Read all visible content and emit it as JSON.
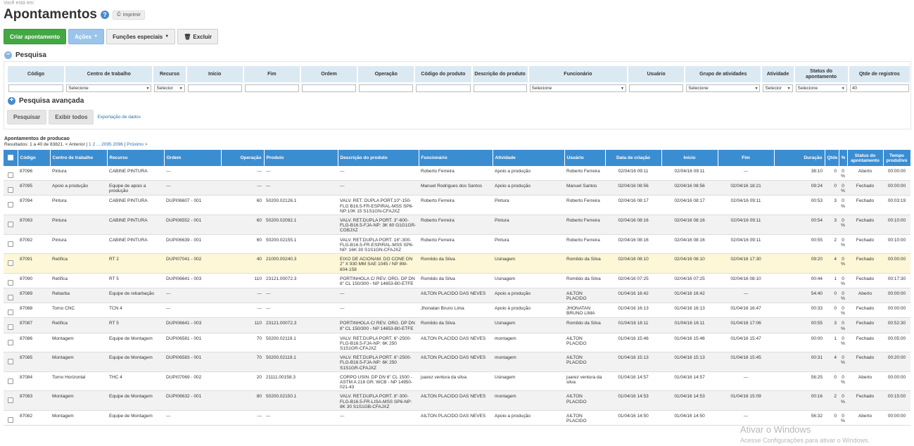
{
  "breadcrumb": "Você está em:",
  "page_title": "Apontamentos",
  "print_label": "Imprimir",
  "toolbar": {
    "create": "Criar apontamento",
    "actions": "Ações",
    "special": "Funções especiais",
    "delete": "Excluir"
  },
  "search": {
    "title": "Pesquisa",
    "advanced": "Pesquisa avançada",
    "search_btn": "Pesquisar",
    "show_all_btn": "Exibir todos",
    "export_link": "Exportação de dados",
    "columns": [
      {
        "label": "Código",
        "value": ""
      },
      {
        "label": "Centro de trabalho",
        "value": "Selecione"
      },
      {
        "label": "Recurso",
        "value": "Selecior"
      },
      {
        "label": "Início",
        "value": ""
      },
      {
        "label": "Fim",
        "value": ""
      },
      {
        "label": "Ordem",
        "value": ""
      },
      {
        "label": "Operação",
        "value": ""
      },
      {
        "label": "Código do produto",
        "value": ""
      },
      {
        "label": "Descrição do produto",
        "value": ""
      },
      {
        "label": "Funcionário",
        "value": "Selecione"
      },
      {
        "label": "Usuário",
        "value": ""
      },
      {
        "label": "Grupo de atividades",
        "value": "Selecione"
      },
      {
        "label": "Atividade",
        "value": "Selecior"
      },
      {
        "label": "Status do apontamento",
        "value": "Selecione"
      },
      {
        "label": "Qtde de registros",
        "value": "40"
      }
    ]
  },
  "results": {
    "title": "Apontamentos de producao",
    "info_prefix": "Resultados: 1 a 40 de 83821. < Anterior |",
    "pages": "1 2 ... 2095 2096",
    "sep": "|",
    "next": "Próximo >"
  },
  "table": {
    "headers": [
      "Código",
      "Centro de trabalho",
      "Recurso",
      "Ordem",
      "Operação",
      "Produto",
      "Descrição do produto",
      "Funcionário",
      "Atividade",
      "Usuário",
      "Data de criação",
      "Início",
      "Fim",
      "Duração",
      "Qtde",
      "%",
      "Status do apontamento",
      "Tempo produtivo"
    ],
    "rows": [
      [
        "87096",
        "Pintura",
        "CABINE PINTURA",
        "---",
        "---",
        "---",
        "---",
        "Roberto Ferreira",
        "Apoio a produção",
        "Roberto Ferreira",
        "02/04/16 09:11",
        "02/04/16 09:11",
        "---",
        "38:10",
        "0",
        "0 %",
        "Aberto",
        "00:00:00"
      ],
      [
        "87095",
        "Apoio a produção",
        "Equipe de apoio a produção",
        "---",
        "---",
        "---",
        "---",
        "Manuel Rodrigues dos Santos",
        "Apoio a produção",
        "Manuel Santos",
        "02/04/16 08:56",
        "02/04/16 08:56",
        "02/04/16 18:21",
        "09:24",
        "0",
        "0 %",
        "Fechado",
        "00:00:00"
      ],
      [
        "87094",
        "Pintura",
        "CABINE PINTURA",
        "DUPI06607 - 001",
        "60",
        "50200.02126.1",
        "VALV. RET. DUPLA PORT.10\"-150-FLG B16.5-FR-ESPIRAL-MSS SP6-NP:10K 15 S1S1GN-CFAJXZ",
        "Roberto Ferreira",
        "Pintura",
        "Roberto Ferreira",
        "02/04/16 08:17",
        "02/04/16 08:17",
        "02/04/16 09:11",
        "00:53",
        "3",
        "0 %",
        "Fechado",
        "00:03:19"
      ],
      [
        "87093",
        "Pintura",
        "CABINE PINTURA",
        "DUPI06552 - 001",
        "60",
        "50200.02092.1",
        "VALV. RET.DUPLA PORT. 3\"-600-FLG-B16.5-FJA-NP: 3K 60 G1G1GR-CGBJXZ",
        "Roberto Ferreira",
        "Pintura",
        "Roberto Ferreira",
        "02/04/16 08:16",
        "02/04/16 08:16",
        "02/04/16 09:11",
        "00:54",
        "3",
        "0 %",
        "Fechado",
        "00:10:00"
      ],
      [
        "87092",
        "Pintura",
        "CABINE PINTURA",
        "DUPI06639 - 001",
        "60",
        "50200.02155.1",
        "VALV. RET.DUPLA PORT. 16\"-300-FLG-B16.5-FR-ESPIRAL-MSS SP6-NP: 16K 30 S1S1GN-CFAJXZ",
        "Roberto Ferreira",
        "Pintura",
        "Roberto Ferreira",
        "02/04/16 08:16",
        "02/04/16 08:16",
        "02/04/16 09:11",
        "00:55",
        "2",
        "0 %",
        "Fechado",
        "00:10:00"
      ],
      [
        "87091",
        "Retífica",
        "RT 2",
        "DUPI07041 - 002",
        "40",
        "21000.00240.3",
        "EIXO DE ACIONAM. DO CONE DN 2\" X 930 MM SAE 1045 / NP 8W-604-158",
        "Romildo da Silva",
        "Usinagem",
        "Romildo da Silva",
        "02/04/16 08:10",
        "02/04/16 08:10",
        "02/04/16 17:30",
        "09:20",
        "4",
        "0 %",
        "Fechado",
        "00:00:00"
      ],
      [
        "87090",
        "Retífica",
        "RT 5",
        "DUPI06641 - 003",
        "110",
        "23121.00072.3",
        "PORTINHOLA C/ REV. ORG. DP DN 8\" CL 150/300 - NP 14653-B0-ETFE",
        "Romildo da Silva",
        "Usinagem",
        "Romildo da Silva",
        "02/04/16 07:25",
        "02/04/16 07:25",
        "02/04/16 08:10",
        "00:44",
        "1",
        "0 %",
        "Fechado",
        "00:17:30"
      ],
      [
        "87089",
        "Rebarba",
        "Equipe de rebarbação",
        "---",
        "---",
        "---",
        "---",
        "AILTON PLACIDO DAS NEVES",
        "Apoio a produção",
        "AILTON PLACIDO",
        "01/04/16 16:42",
        "01/04/16 16:42",
        "---",
        "54:40",
        "0",
        "0 %",
        "Aberto",
        "00:00:00"
      ],
      [
        "87088",
        "Torno CNC",
        "TCN 4",
        "---",
        "---",
        "---",
        "---",
        "Jhonatan Bruno Lima",
        "Apoio à produção",
        "JHONATAN BRUNO LIMA",
        "01/04/16 16:13",
        "01/04/16 16:13",
        "01/04/16 16:47",
        "00:33",
        "0",
        "0 %",
        "Fechado",
        "00:00:00"
      ],
      [
        "87087",
        "Retífica",
        "RT 5",
        "DUPI06641 - 003",
        "110",
        "23121.00072.3",
        "PORTINHOLA C/ REV. ORG. DP DN 8\" CL 150/300 - NP 14653-B0-ETFE",
        "Romildo da Silva",
        "Usinagem",
        "Romildo da Silva",
        "01/04/16 16:11",
        "01/04/16 16:11",
        "01/04/16 17:06",
        "00:55",
        "3",
        "0 %",
        "Fechado",
        "00:52:30"
      ],
      [
        "87086",
        "Montagem",
        "Equipe de Montagem",
        "DUPI06581 - 001",
        "70",
        "50200.02119.1",
        "VALV. RET.DUPLA PORT. 6\"-2500-FLG-B16.5-FJA-NP: 6K 250 S1S1GR-CFAJXZ",
        "AILTON PLACIDO DAS NEVES",
        "montagem",
        "AILTON PLACIDO",
        "01/04/16 15:46",
        "01/04/16 15:46",
        "01/04/16 15:47",
        "00:00",
        "1",
        "0 %",
        "Fechado",
        "00:05:00"
      ],
      [
        "87085",
        "Montagem",
        "Equipe de Montagem",
        "DUPI06583 - 001",
        "70",
        "50200.02119.1",
        "VALV. RET.DUPLA PORT. 6\"-2500-FLG-B16.5-FJA-NP: 6K 250 S1S1GR-CFAJXZ",
        "AILTON PLACIDO DAS NEVES",
        "montagem",
        "AILTON PLACIDO",
        "01/04/16 15:13",
        "01/04/16 15:13",
        "01/04/16 15:45",
        "00:31",
        "4",
        "0 %",
        "Fechado",
        "00:20:00"
      ],
      [
        "87084",
        "Torno Horizontal",
        "THC 4",
        "DUPI07069 - 002",
        "20",
        "21111.00158.3",
        "CORPO USIN. DP DN 6\" CL 1500 - ASTM A 216 GR. WCB - NP 14950-021-43",
        "juarez ventura da silva",
        "Usinagem",
        "juarez ventura da silva",
        "01/04/16 14:57",
        "01/04/16 14:57",
        "---",
        "56:25",
        "0",
        "0 %",
        "Aberto",
        "00:00:00"
      ],
      [
        "87083",
        "Montagem",
        "Equipe de Montagem",
        "DUPI06632 - 001",
        "80",
        "50200.02150.1",
        "VALV. RET.DUPLA PORT. 8\"-300-FLG-B16.5-FR-LISA-MSS SP6-NP: 8K 30 S1S1GB-CFAJXZ",
        "AILTON PLACIDO DAS NEVES",
        "montagem",
        "AILTON PLACIDO",
        "01/04/16 14:53",
        "01/04/16 14:53",
        "01/04/16 15:09",
        "00:16",
        "2",
        "0 %",
        "Fechado",
        "00:15:00"
      ],
      [
        "87082",
        "Montagem",
        "Equipe de Montagem",
        "---",
        "---",
        "---",
        "---",
        "AILTON PLACIDO DAS NEVES",
        "Apoio a produção",
        "AILTON PLACIDO",
        "01/04/16 14:50",
        "01/04/16 14:50",
        "---",
        "56:32",
        "0",
        "0 %",
        "Aberto",
        "00:00:00"
      ]
    ]
  },
  "watermark": {
    "line1": "Ativar o Windows",
    "line2": "Acesse Configurações para ativar o Windows."
  }
}
